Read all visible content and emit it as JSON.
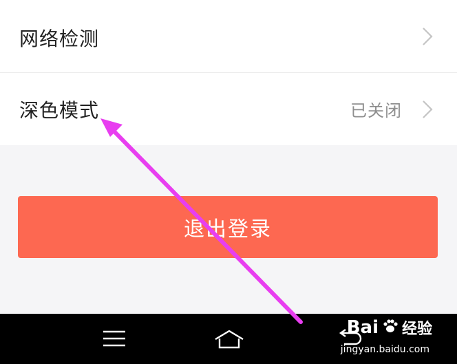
{
  "settings": {
    "items": [
      {
        "label": "网络检测",
        "value": ""
      },
      {
        "label": "深色模式",
        "value": "已关闭"
      }
    ]
  },
  "logout": {
    "label": "退出登录"
  },
  "watermark": {
    "brand": "Bai",
    "brand2": "经验",
    "url": "jingyan.baidu.com"
  },
  "colors": {
    "logout_bg": "#fd6851",
    "annotation_arrow": "#e83ef0",
    "nav_bg": "#000000"
  },
  "icons": {
    "chevron": "chevron-right-icon",
    "nav_menu": "menu-icon",
    "nav_home": "home-icon",
    "nav_back": "back-icon",
    "paw": "paw-icon"
  }
}
